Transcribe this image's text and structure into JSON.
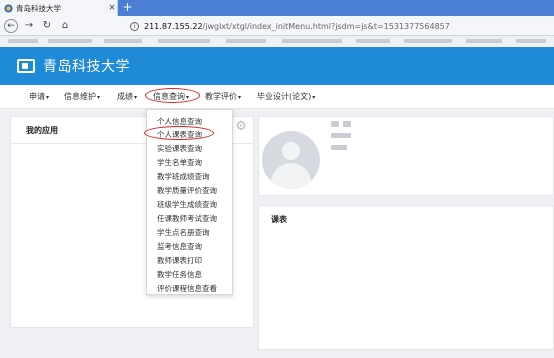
{
  "browser": {
    "tab_title": "青岛科技大学",
    "tab_close": "×",
    "new_tab": "+",
    "url_host": "211.87.155.22",
    "url_rest": "/jwglxt/xtgl/index_initMenu.html?jsdm=js&t=1531377564857"
  },
  "app": {
    "title": "青岛科技大学"
  },
  "menu": {
    "items": [
      {
        "label": "申请"
      },
      {
        "label": "信息维护"
      },
      {
        "label": "成绩"
      },
      {
        "label": "信息查询"
      },
      {
        "label": "教学评价"
      },
      {
        "label": "毕业设计(论文)"
      }
    ],
    "caret": "▾"
  },
  "dropdown": {
    "items": [
      "个人信息查询",
      "个人课表查询",
      "实验课表查询",
      "学生名单查询",
      "教学班成绩查询",
      "教学质量评价查询",
      "班级学生成绩查询",
      "任课教师考试查询",
      "学生点名册查询",
      "监考信息查询",
      "教师课表打印",
      "教学任务信息",
      "评价课程信息查看"
    ]
  },
  "panels": {
    "my_apps_title": "我的应用",
    "schedule_title": "课表"
  },
  "colors": {
    "header_blue": "#1f8ad8",
    "tabstrip_blue": "#4a7fd4",
    "highlight_red": "#dd2222"
  },
  "icons": {
    "favicon": "university-seal-icon",
    "back": "arrow-left-icon",
    "forward": "arrow-right-icon",
    "reload": "reload-icon",
    "home": "home-icon",
    "info": "info-icon",
    "logo": "monitor-logo-icon",
    "settings": "gear-icon",
    "avatar": "default-avatar-icon"
  }
}
